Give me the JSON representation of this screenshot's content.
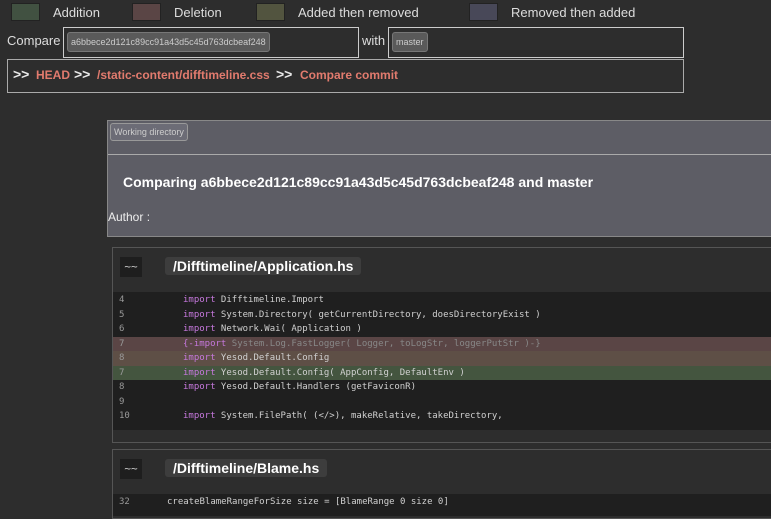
{
  "legend": [
    {
      "label": "Addition",
      "color": "#415141"
    },
    {
      "label": "Deletion",
      "color": "#5a4545"
    },
    {
      "label": "Added then removed",
      "color": "#52543f"
    },
    {
      "label": "Removed then added",
      "color": "#484858"
    }
  ],
  "compare": {
    "label": "Compare",
    "from": "a6bbece2d121c89cc91a43d5c45d763dcbeaf248",
    "with_label": "with",
    "to": "master"
  },
  "breadcrumb": {
    "arrow": ">>",
    "items": [
      "HEAD",
      "/static-content/difftimeline.css",
      "Compare commit"
    ]
  },
  "info": {
    "working_dir": "Working directory",
    "title": "Comparing a6bbece2d121c89cc91a43d5c45d763dcbeaf248 and master",
    "author": "Author :"
  },
  "files": [
    {
      "icon": "~~",
      "name": "/Difftimeline/Application.hs",
      "lines": [
        {
          "num": "4",
          "kw": "import",
          "rest": " Difftimeline.Import",
          "type": ""
        },
        {
          "num": "5",
          "kw": "import",
          "rest": " System.Directory( getCurrentDirectory, doesDirectoryExist )",
          "type": ""
        },
        {
          "num": "6",
          "kw": "import",
          "rest": " Network.Wai( Application )",
          "type": ""
        },
        {
          "num": "7",
          "kw": "{-import",
          "rest": " System.Log.FastLogger( Logger, toLogStr, loggerPutStr )-}",
          "type": "del"
        },
        {
          "num": "8",
          "kw": "import",
          "rest": " Yesod.Default.Config",
          "type": "mix"
        },
        {
          "num": "7",
          "kw": "import",
          "rest": " Yesod.Default.Config( AppConfig, DefaultEnv )",
          "type": "add"
        },
        {
          "num": "8",
          "kw": "import",
          "rest": " Yesod.Default.Handlers (getFaviconR)",
          "type": ""
        },
        {
          "num": "9",
          "kw": "",
          "rest": "",
          "type": ""
        },
        {
          "num": "10",
          "kw": "import",
          "rest": " System.FilePath( (</>), makeRelative, takeDirectory,",
          "type": ""
        }
      ]
    },
    {
      "icon": "~~",
      "name": "/Difftimeline/Blame.hs",
      "lines": [
        {
          "num": "32",
          "kw": "",
          "rest": "createBlameRangeForSize size = [BlameRange 0 size 0]",
          "type": ""
        }
      ]
    }
  ]
}
